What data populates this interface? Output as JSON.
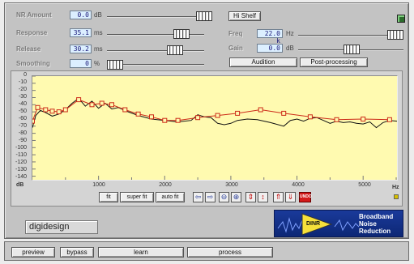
{
  "params": {
    "nr_amount": {
      "label": "NR Amount",
      "value": "0.0",
      "unit": "dB"
    },
    "response": {
      "label": "Response",
      "value": "35.1",
      "unit": "ms"
    },
    "release": {
      "label": "Release",
      "value": "30.2",
      "unit": "ms"
    },
    "smoothing": {
      "label": "Smoothing",
      "value": "0",
      "unit": "%"
    }
  },
  "filter": {
    "type_label": "Hi Shelf",
    "freq": {
      "label": "Freq",
      "value": "22.0 k",
      "unit": "Hz"
    },
    "gain": {
      "label": "Gain",
      "value": "0.0",
      "unit": "dB"
    },
    "audition_label": "Audition",
    "postprocessing_label": "Post-processing"
  },
  "graph": {
    "y_unit": "dB",
    "x_unit": "Hz",
    "y_ticks": [
      "0",
      "-10",
      "-20",
      "-30",
      "-40",
      "-50",
      "-60",
      "-70",
      "-80",
      "-90",
      "-100",
      "-110",
      "-120",
      "-130",
      "-140"
    ],
    "x_ticks": [
      "1000",
      "2000",
      "3000",
      "4000",
      "5000"
    ]
  },
  "toolbar": {
    "fit": "fit",
    "super_fit": "super fit",
    "auto_fit": "auto fit",
    "undo": "UNDO"
  },
  "brand": {
    "logo": "digidesign",
    "plugin_badge": "DINR",
    "plugin_name_1": "Broadband",
    "plugin_name_2": "Noise",
    "plugin_name_3": "Reduction"
  },
  "bottom_buttons": {
    "preview": "preview",
    "bypass": "bypass",
    "learn": "learn",
    "process": "process"
  },
  "colors": {
    "plot_bg": "#fffab0",
    "curve_red": "#cc2a18",
    "curve_black": "#111111",
    "brand_blue": "#1a3a9a",
    "badge_yellow": "#f6e03a"
  },
  "chart_data": {
    "type": "line",
    "xlabel": "Hz",
    "ylabel": "dB",
    "xlim": [
      0,
      5512
    ],
    "ylim": [
      -145,
      0
    ],
    "series": [
      {
        "x": [
          0,
          80,
          200,
          300,
          400,
          500,
          700,
          900,
          1050,
          1200,
          1400,
          1600,
          1800,
          2000,
          2200,
          2500,
          2800,
          3100,
          3450,
          3800,
          4200,
          4600,
          5000,
          5400
        ],
        "values": [
          -63,
          -44,
          -47,
          -49,
          -50,
          -47,
          -33,
          -40,
          -38,
          -40,
          -47,
          -53,
          -57,
          -62,
          -62,
          -58,
          -55,
          -52,
          -47,
          -52,
          -57,
          -61,
          -60,
          -61
        ]
      },
      {
        "x": [
          0,
          50,
          120,
          200,
          300,
          400,
          500,
          600,
          700,
          800,
          900,
          1000,
          1100,
          1200,
          1300,
          1450,
          1600,
          1800,
          2000,
          2200,
          2400,
          2500,
          2600,
          2700,
          2800,
          2900,
          3000,
          3100,
          3250,
          3400,
          3600,
          3800,
          3900,
          4000,
          4100,
          4200,
          4300,
          4400,
          4500,
          4600,
          4700,
          4800,
          4900,
          5000,
          5100,
          5200,
          5300,
          5400,
          5512
        ],
        "values": [
          -72,
          -55,
          -48,
          -51,
          -56,
          -53,
          -47,
          -38,
          -31,
          -42,
          -35,
          -45,
          -38,
          -46,
          -44,
          -50,
          -55,
          -60,
          -62,
          -64,
          -62,
          -54,
          -57,
          -58,
          -66,
          -68,
          -66,
          -62,
          -60,
          -61,
          -65,
          -70,
          -62,
          -60,
          -63,
          -59,
          -58,
          -62,
          -66,
          -63,
          -65,
          -64,
          -66,
          -67,
          -64,
          -72,
          -65,
          -62,
          -63
        ]
      }
    ]
  }
}
